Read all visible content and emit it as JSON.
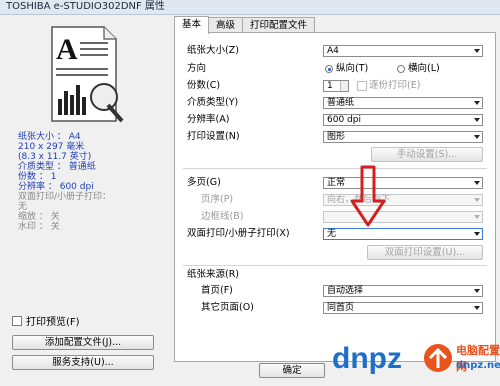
{
  "window": {
    "title": "TOSHIBA e-STUDIO302DNF 属性"
  },
  "summary": {
    "paper_size": "纸张大小 ： A4",
    "dims_mm": "210 x 297 毫米",
    "dims_in": "(8.3 x 11.7 英寸)",
    "paper_type": "介质类型 ： 普通纸",
    "copies": "份数 ： 1",
    "resolution": "分辨率 ： 600 dpi",
    "duplex": "双面打印/小册子打印：",
    "duplex_value": "无",
    "scale": "缩放 ： 关",
    "watermark": "水印 ： 关"
  },
  "left_panel": {
    "print_preview_label": "打印预览(F)",
    "add_profile_button": "添加配置文件(J)...",
    "support_button": "服务支持(U)..."
  },
  "tabs": [
    "基本",
    "高级",
    "打印配置文件"
  ],
  "basic": {
    "paper_size_label": "纸张大小(Z)",
    "paper_size_value": "A4",
    "orientation_label": "方向",
    "portrait_label": "纵向(T)",
    "landscape_label": "横向(L)",
    "copies_label": "份数(C)",
    "copies_value": "1",
    "collate_label": "逐份打印(E)",
    "media_type_label": "介质类型(Y)",
    "media_type_value": "普通纸",
    "resolution_label": "分辨率(A)",
    "resolution_value": "600 dpi",
    "print_settings_label": "打印设置(N)",
    "print_settings_value": "图形",
    "manual_settings_button": "手动设置(S)...",
    "multipage_label": "多页(G)",
    "multipage_value": "正常",
    "page_order_label": "页序(P)",
    "page_order_value": "向右，然后向下",
    "border_label": "边框线(B)",
    "duplex_label": "双面打印/小册子打印(X)",
    "duplex_value": "无",
    "duplex_settings_button": "双面打印设置(U)...",
    "paper_source_label": "纸张来源(R)",
    "first_page_label": "首页(F)",
    "first_page_value": "自动选择",
    "other_pages_label": "其它页面(O)",
    "other_pages_value": "同首页"
  },
  "footer": {
    "ok_button": "确定"
  },
  "brand": {
    "logo_text": "dnpz.net",
    "tagline": "电脑配置网",
    "accent": "#e8531e",
    "blue": "#1f6fc8",
    "annotation_color": "#d42020"
  }
}
